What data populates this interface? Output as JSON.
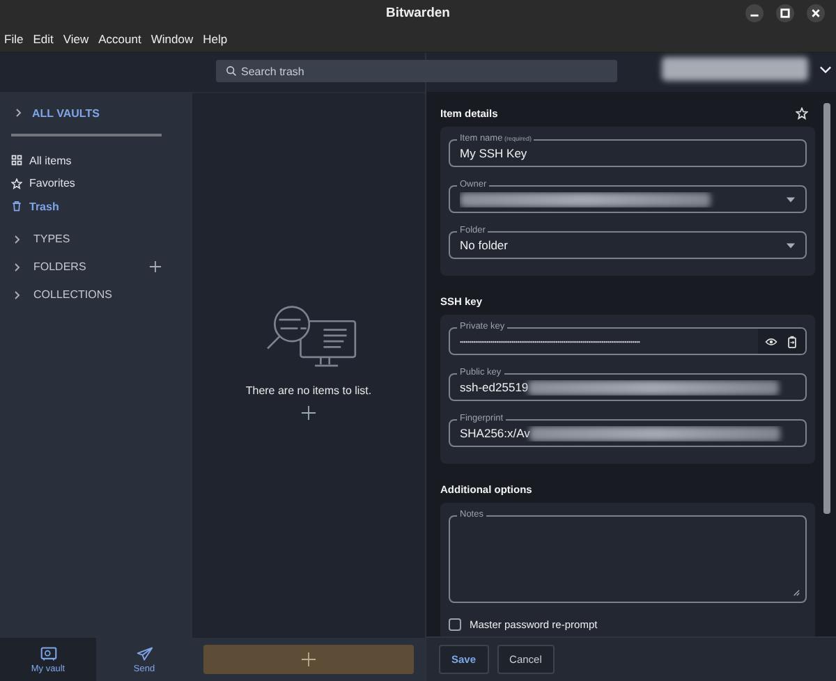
{
  "window": {
    "title": "Bitwarden"
  },
  "menu": [
    "File",
    "Edit",
    "View",
    "Account",
    "Window",
    "Help"
  ],
  "search": {
    "placeholder": "Search trash"
  },
  "sidebar": {
    "vault_filter": {
      "label": "ALL VAULTS",
      "expanded": false
    },
    "items": [
      {
        "label": "All items",
        "kind": "grid",
        "selected": false
      },
      {
        "label": "Favorites",
        "kind": "star",
        "selected": false
      },
      {
        "label": "Trash",
        "kind": "trash",
        "selected": true
      }
    ],
    "sections": [
      {
        "label": "TYPES",
        "expanded": false,
        "addable": false
      },
      {
        "label": "FOLDERS",
        "expanded": false,
        "addable": true
      },
      {
        "label": "COLLECTIONS",
        "expanded": false,
        "addable": false
      }
    ]
  },
  "bottom_nav": [
    {
      "label": "My vault",
      "kind": "vault",
      "selected": true
    },
    {
      "label": "Send",
      "kind": "send",
      "selected": false
    }
  ],
  "list": {
    "empty_message": "There are no items to list."
  },
  "details": {
    "sections": [
      {
        "title": "Item details",
        "favorite": false,
        "fields": [
          {
            "kind": "text",
            "label": "Item name",
            "required_note": "(required)",
            "value": "My SSH Key"
          },
          {
            "kind": "select",
            "label": "Owner",
            "redacted": true
          },
          {
            "kind": "select",
            "label": "Folder",
            "value": "No folder"
          }
        ]
      },
      {
        "title": "SSH key",
        "fields": [
          {
            "kind": "secret",
            "label": "Private key",
            "value": "••••••••••••••••••••••••••••••••••••••••••••••••••••••••••••••••••••••••••••••••••••••••••••••"
          },
          {
            "kind": "text",
            "label": "Public key",
            "value": "ssh-ed25519",
            "redacted": true
          },
          {
            "kind": "text",
            "label": "Fingerprint",
            "value": "SHA256:x/Av",
            "redacted": true
          }
        ]
      },
      {
        "title": "Additional options",
        "fields": [
          {
            "kind": "textarea",
            "label": "Notes"
          },
          {
            "kind": "checkbox",
            "label": "Master password re-prompt",
            "checked": false
          }
        ]
      }
    ]
  },
  "footer": {
    "buttons": [
      {
        "label": "Save",
        "kind": "primary"
      },
      {
        "label": "Cancel",
        "kind": "secondary"
      }
    ]
  }
}
